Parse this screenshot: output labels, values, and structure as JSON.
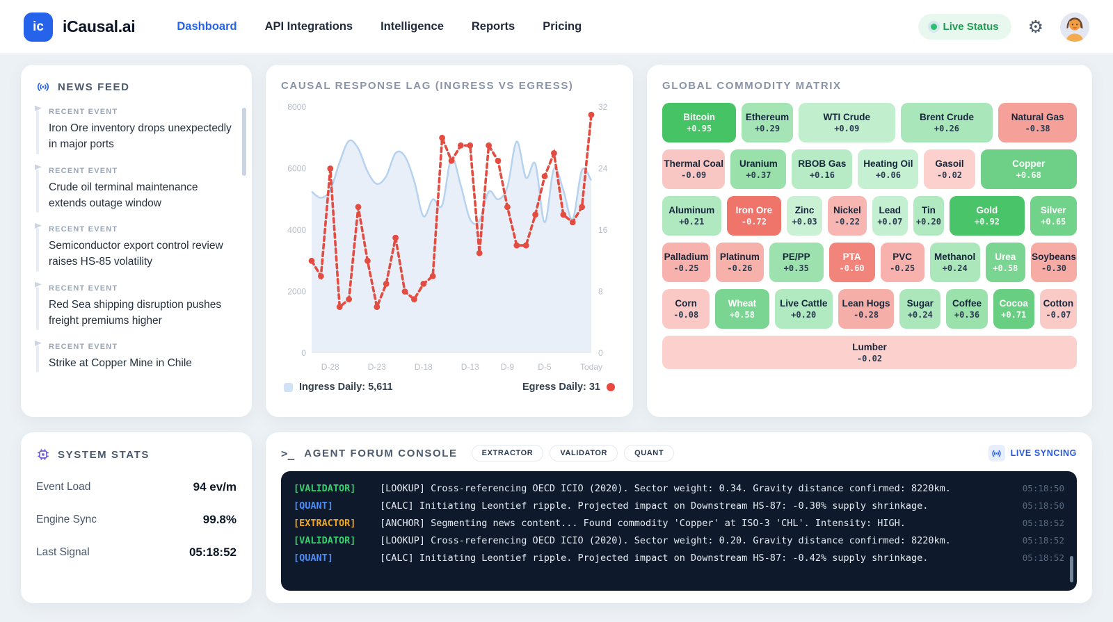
{
  "nav": {
    "logo_short": "ic",
    "brand": "iCausal.ai",
    "items": [
      {
        "label": "Dashboard",
        "active": true
      },
      {
        "label": "API Integrations",
        "active": false
      },
      {
        "label": "Intelligence",
        "active": false
      },
      {
        "label": "Reports",
        "active": false
      },
      {
        "label": "Pricing",
        "active": false
      }
    ],
    "live_status": "Live Status"
  },
  "news_feed": {
    "title": "NEWS FEED",
    "item_label": "RECENT EVENT",
    "items": [
      "Iron Ore inventory drops unexpectedly in major ports",
      "Crude oil terminal maintenance extends outage window",
      "Semiconductor export control review raises HS-85 volatility",
      "Red Sea shipping disruption pushes freight premiums higher",
      "Strike at Copper Mine in Chile"
    ]
  },
  "chart": {
    "title": "CAUSAL RESPONSE LAG (INGRESS VS EGRESS)",
    "legend_left": "Ingress Daily: 5,611",
    "legend_right": "Egress Daily: 31"
  },
  "chart_data": {
    "type": "line",
    "title": "CAUSAL RESPONSE LAG (INGRESS VS EGRESS)",
    "x_tick_labels": [
      "D-28",
      "D-23",
      "D-18",
      "D-13",
      "D-9",
      "D-5",
      "Today"
    ],
    "x_tick_indices": [
      2,
      7,
      12,
      17,
      21,
      25,
      30
    ],
    "left_axis": {
      "ticks": [
        0,
        2000,
        4000,
        6000,
        8000
      ],
      "range": [
        0,
        8000
      ]
    },
    "right_axis": {
      "ticks": [
        0,
        8,
        16,
        24,
        32
      ],
      "range": [
        0,
        32
      ]
    },
    "series": [
      {
        "name": "Ingress Daily",
        "axis": "left",
        "style": "smooth-area",
        "today_value": 5611,
        "values": [
          5250,
          5050,
          5300,
          6200,
          6900,
          6650,
          5900,
          5500,
          5750,
          6500,
          6400,
          5600,
          4450,
          5000,
          4800,
          6350,
          5450,
          4350,
          4300,
          5250,
          5000,
          5400,
          6880,
          5700,
          6150,
          4250,
          6000,
          5300,
          4350,
          5950,
          5611
        ]
      },
      {
        "name": "Egress Daily",
        "axis": "right",
        "style": "dashed-dots",
        "today_value": 31,
        "values": [
          12,
          10,
          24,
          6,
          7,
          19,
          12,
          6,
          9,
          15,
          8,
          7,
          9,
          10,
          28,
          25,
          27,
          27,
          13,
          27,
          25,
          19,
          14,
          14,
          18,
          23,
          26,
          18,
          17,
          19,
          31
        ]
      }
    ],
    "grid": false,
    "legend_position": "bottom"
  },
  "matrix": {
    "title": "GLOBAL COMMODITY MATRIX",
    "rows": [
      [
        {
          "name": "Bitcoin",
          "value": 0.95,
          "w": 1.5
        },
        {
          "name": "Ethereum",
          "value": 0.29,
          "w": 1.0
        },
        {
          "name": "WTI Crude",
          "value": 0.09,
          "w": 2.0
        },
        {
          "name": "Brent Crude",
          "value": 0.26,
          "w": 1.9
        },
        {
          "name": "Natural Gas",
          "value": -0.38,
          "w": 1.6
        }
      ],
      [
        {
          "name": "Thermal Coal",
          "value": -0.09,
          "w": 1.2
        },
        {
          "name": "Uranium",
          "value": 0.37,
          "w": 1.05
        },
        {
          "name": "RBOB Gas",
          "value": 0.16,
          "w": 1.15
        },
        {
          "name": "Heating Oil",
          "value": 0.06,
          "w": 1.15
        },
        {
          "name": "Gasoil",
          "value": -0.02,
          "w": 0.95
        },
        {
          "name": "Copper",
          "value": 0.68,
          "w": 1.9
        }
      ],
      [
        {
          "name": "Aluminum",
          "value": 0.21,
          "w": 1.35
        },
        {
          "name": "Iron Ore",
          "value": -0.72,
          "w": 1.25
        },
        {
          "name": "Zinc",
          "value": 0.03,
          "w": 0.75
        },
        {
          "name": "Nickel",
          "value": -0.22,
          "w": 0.85
        },
        {
          "name": "Lead",
          "value": 0.07,
          "w": 0.75
        },
        {
          "name": "Tin",
          "value": 0.2,
          "w": 0.65
        },
        {
          "name": "Gold",
          "value": 0.92,
          "w": 1.75
        },
        {
          "name": "Silver",
          "value": 0.65,
          "w": 1.05
        }
      ],
      [
        {
          "name": "Palladium",
          "value": -0.25,
          "w": 1.05
        },
        {
          "name": "Platinum",
          "value": -0.26,
          "w": 1.05
        },
        {
          "name": "PE/PP",
          "value": 0.35,
          "w": 1.2
        },
        {
          "name": "PTA",
          "value": -0.6,
          "w": 1.0
        },
        {
          "name": "PVC",
          "value": -0.25,
          "w": 0.95
        },
        {
          "name": "Methanol",
          "value": 0.24,
          "w": 1.1
        },
        {
          "name": "Urea",
          "value": 0.58,
          "w": 0.85
        },
        {
          "name": "Soybeans",
          "value": -0.3,
          "w": 1.0
        }
      ],
      [
        {
          "name": "Corn",
          "value": -0.08,
          "w": 1.0
        },
        {
          "name": "Wheat",
          "value": 0.58,
          "w": 1.15
        },
        {
          "name": "Live Cattle",
          "value": 0.2,
          "w": 1.25
        },
        {
          "name": "Lean Hogs",
          "value": -0.28,
          "w": 1.2
        },
        {
          "name": "Sugar",
          "value": 0.24,
          "w": 0.85
        },
        {
          "name": "Coffee",
          "value": 0.36,
          "w": 0.85
        },
        {
          "name": "Cocoa",
          "value": 0.71,
          "w": 0.85
        },
        {
          "name": "Cotton",
          "value": -0.07,
          "w": 0.75
        }
      ],
      [
        {
          "name": "Lumber",
          "value": -0.02,
          "w": 1.0,
          "wide": true
        }
      ]
    ]
  },
  "stats": {
    "title": "SYSTEM STATS",
    "rows": [
      {
        "label": "Event Load",
        "value": "94 ev/m"
      },
      {
        "label": "Engine Sync",
        "value": "99.8%"
      },
      {
        "label": "Last Signal",
        "value": "05:18:52"
      }
    ]
  },
  "console": {
    "title": "AGENT FORUM CONSOLE",
    "prompt": ">_",
    "pills": [
      "EXTRACTOR",
      "VALIDATOR",
      "QUANT"
    ],
    "live_syncing": "LIVE SYNCING",
    "lines": [
      {
        "agent": "VALIDATOR",
        "msg": "[LOOKUP] Cross-referencing OECD ICIO (2020). Sector weight: 0.34. Gravity distance confirmed: 8220km.",
        "time": "05:18:50"
      },
      {
        "agent": "QUANT",
        "msg": "[CALC] Initiating Leontief ripple. Projected impact on Downstream HS-87: -0.30% supply shrinkage.",
        "time": "05:18:50"
      },
      {
        "agent": "EXTRACTOR",
        "msg": "[ANCHOR] Segmenting news content... Found commodity 'Copper' at ISO-3 'CHL'. Intensity: HIGH.",
        "time": "05:18:52"
      },
      {
        "agent": "VALIDATOR",
        "msg": "[LOOKUP] Cross-referencing OECD ICIO (2020). Sector weight: 0.20. Gravity distance confirmed: 8220km.",
        "time": "05:18:52"
      },
      {
        "agent": "QUANT",
        "msg": "[CALC] Initiating Leontief ripple. Projected impact on Downstream HS-87: -0.42% supply shrinkage.",
        "time": "05:18:52"
      }
    ]
  },
  "colors": {
    "accent_blue": "#2563eb",
    "live_green": "#2fbe6e",
    "pos_strong": "#3fc05f",
    "pos_pale": "#cef3d8",
    "neg_strong": "#ea4f42",
    "neg_pale": "#fbd3d0",
    "white_text_threshold": 0.5,
    "console_bg": "#0e1a2b",
    "agent_validator": "#36d16c",
    "agent_quant": "#4a8df8",
    "agent_extractor": "#f2a71f",
    "ingress_line": "#b5d2ef",
    "ingress_fill": "#e9eff8",
    "egress_red": "#e34c41",
    "chip_purple": "#6d5bd0"
  }
}
